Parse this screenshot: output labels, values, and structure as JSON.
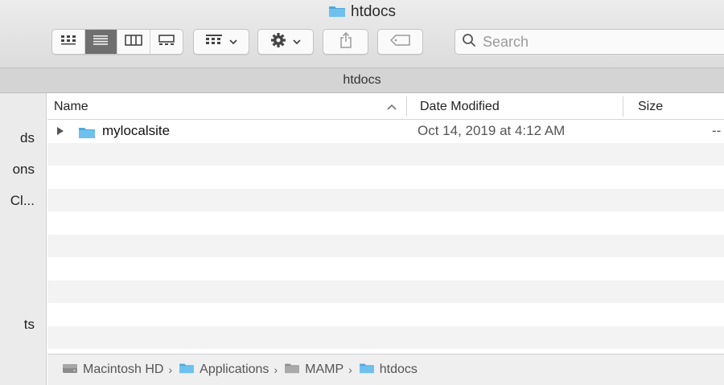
{
  "window": {
    "title": "htdocs"
  },
  "toolbar": {
    "view_buttons": [
      {
        "name": "icon-view",
        "icon": "grid-icon",
        "active": false
      },
      {
        "name": "list-view",
        "icon": "list-icon",
        "active": true
      },
      {
        "name": "column-view",
        "icon": "columns-icon",
        "active": false
      },
      {
        "name": "gallery-view",
        "icon": "gallery-icon",
        "active": false
      }
    ],
    "group_icon": "group-icon",
    "action_icon": "gear-icon",
    "share_icon": "share-icon",
    "tag_icon": "tag-icon"
  },
  "search": {
    "placeholder": "Search"
  },
  "path_tab": {
    "label": "htdocs"
  },
  "sidebar": {
    "items": [
      {
        "label": "ds"
      },
      {
        "label": "ons"
      },
      {
        "label": "Cl..."
      },
      {
        "label": "ts"
      }
    ]
  },
  "columns": {
    "name": "Name",
    "date_modified": "Date Modified",
    "size": "Size"
  },
  "files": [
    {
      "name": "mylocalsite",
      "date_modified": "Oct 14, 2019 at 4:12 AM",
      "size": "--",
      "kind": "folder"
    }
  ],
  "breadcrumb": [
    {
      "label": "Macintosh HD",
      "icon": "hard-drive-icon"
    },
    {
      "label": "Applications",
      "icon": "folder-icon"
    },
    {
      "label": "MAMP",
      "icon": "folder-icon"
    },
    {
      "label": "htdocs",
      "icon": "folder-icon"
    }
  ],
  "colors": {
    "folder": "#6ec1ef",
    "folder_dark": "#4fa8dd",
    "active_segment": "#6f6f6f"
  }
}
